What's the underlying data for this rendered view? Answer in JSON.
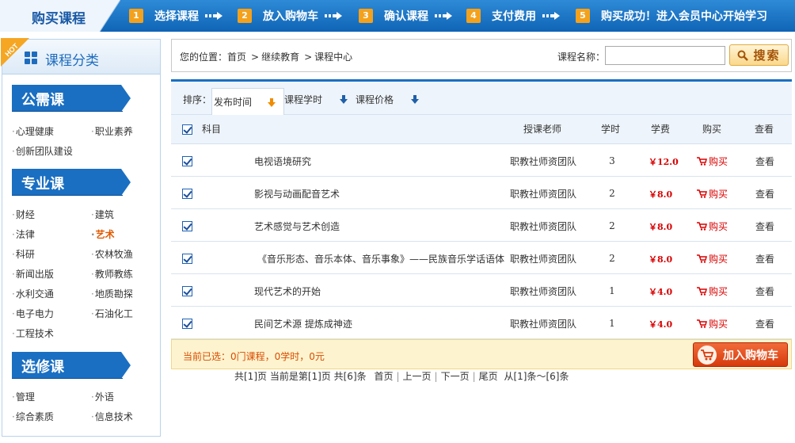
{
  "header": {
    "title": "购买课程",
    "steps": [
      {
        "num": "1",
        "label": "选择课程"
      },
      {
        "num": "2",
        "label": "放入购物车"
      },
      {
        "num": "3",
        "label": "确认课程"
      },
      {
        "num": "4",
        "label": "支付费用"
      },
      {
        "num": "5",
        "label": "购买成功！进入会员中心开始学习"
      }
    ]
  },
  "sidebar": {
    "badge": "HOT",
    "title": "课程分类",
    "sections": [
      {
        "title": "公需课",
        "items": [
          "心理健康",
          "职业素养",
          "创新团队建设"
        ]
      },
      {
        "title": "专业课",
        "items": [
          "财经",
          "建筑",
          "法律",
          "艺术",
          "科研",
          "农林牧渔",
          "新闻出版",
          "教师教练",
          "水利交通",
          "地质勘探",
          "电子电力",
          "石油化工",
          "工程技术"
        ],
        "active": "艺术"
      },
      {
        "title": "选修课",
        "items": [
          "管理",
          "外语",
          "综合素质",
          "信息技术"
        ]
      }
    ]
  },
  "breadcrumb": {
    "prefix": "您的位置：",
    "items": [
      "首页",
      "继续教育",
      "课程中心"
    ]
  },
  "search": {
    "label": "课程名称：",
    "value": "",
    "placeholder": "",
    "button": "搜索"
  },
  "sort": {
    "label": "排序：",
    "keys": [
      "发布时间",
      "课程学时",
      "课程价格"
    ],
    "active": "发布时间"
  },
  "table": {
    "headers": {
      "subject": "科目",
      "teacher": "授课老师",
      "hours": "学时",
      "fee": "学费",
      "buy": "购买",
      "view": "查看"
    },
    "rows": [
      {
        "name": "电视语境研究",
        "teacher": "职教社师资团队",
        "hours": "3",
        "price": "￥12.0",
        "buy": "购买",
        "view": "查看"
      },
      {
        "name": "影视与动画配音艺术",
        "teacher": "职教社师资团队",
        "hours": "2",
        "price": "￥8.0",
        "buy": "购买",
        "view": "查看"
      },
      {
        "name": "艺术感觉与艺术创造",
        "teacher": "职教社师资团队",
        "hours": "2",
        "price": "￥8.0",
        "buy": "购买",
        "view": "查看"
      },
      {
        "name": "《音乐形态、音乐本体、音乐事象》——民族音乐学话语体",
        "teacher": "职教社师资团队",
        "hours": "2",
        "price": "￥8.0",
        "buy": "购买",
        "view": "查看"
      },
      {
        "name": "现代艺术的开始",
        "teacher": "职教社师资团队",
        "hours": "1",
        "price": "￥4.0",
        "buy": "购买",
        "view": "查看"
      },
      {
        "name": "民间艺术源 提炼成神迹",
        "teacher": "职教社师资团队",
        "hours": "1",
        "price": "￥4.0",
        "buy": "购买",
        "view": "查看"
      }
    ]
  },
  "summary": {
    "text": "当前已选：0门课程，0学时，0元",
    "cart_button": "加入购物车"
  },
  "pager": {
    "info": "共[1]页  当前是第[1]页  共[6]条",
    "first": "首页",
    "prev": "上一页",
    "next": "下一页",
    "last": "尾页",
    "range": "从[1]条～[6]条"
  },
  "colors": {
    "primary": "#1a6fc2",
    "accent": "#f4a11c",
    "price": "#d90000",
    "cart": "#d63a0c"
  }
}
